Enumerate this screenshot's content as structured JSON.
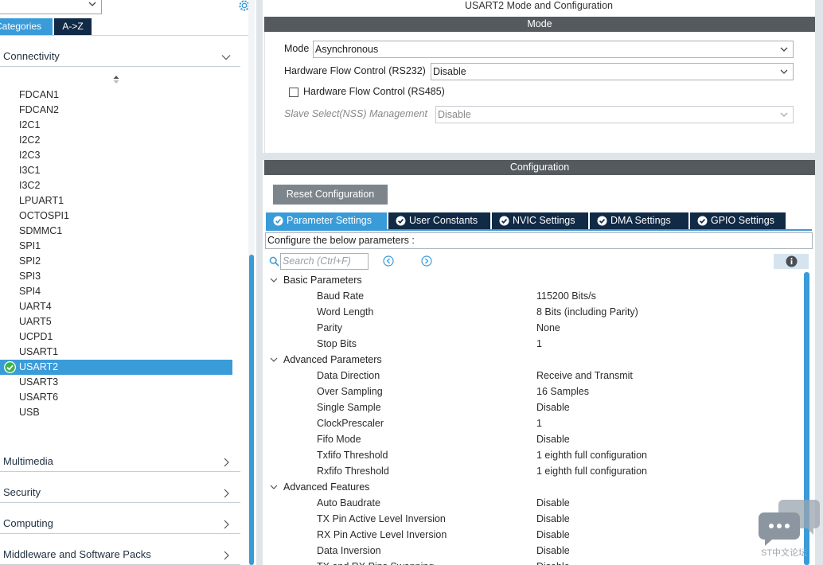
{
  "left_panel": {
    "tabs": {
      "categories": "Categories",
      "az": "A->Z"
    },
    "categories": [
      {
        "label": "Connectivity",
        "expanded": true
      },
      {
        "label": "Multimedia",
        "expanded": false
      },
      {
        "label": "Security",
        "expanded": false
      },
      {
        "label": "Computing",
        "expanded": false
      },
      {
        "label": "Middleware and Software Packs",
        "expanded": false
      }
    ],
    "peripherals": [
      "FDCAN1",
      "FDCAN2",
      "I2C1",
      "I2C2",
      "I2C3",
      "I3C1",
      "I3C2",
      "LPUART1",
      "OCTOSPI1",
      "SDMMC1",
      "SPI1",
      "SPI2",
      "SPI3",
      "SPI4",
      "UART4",
      "UART5",
      "UCPD1",
      "USART1",
      "USART2",
      "USART3",
      "USART6",
      "USB"
    ],
    "selected_index": 18
  },
  "mode_section": {
    "window_title": "USART2 Mode and Configuration",
    "header": "Mode",
    "mode": {
      "label": "Mode",
      "value": "Asynchronous"
    },
    "hw_flow_rs232": {
      "label": "Hardware Flow Control (RS232)",
      "value": "Disable"
    },
    "hw_flow_rs485": {
      "label": "Hardware Flow Control (RS485)",
      "checked": false
    },
    "slave_select": {
      "label": "Slave Select(NSS) Management",
      "value": "Disable",
      "disabled": true
    }
  },
  "config_section": {
    "header": "Configuration",
    "reset_label": "Reset Configuration",
    "tabs": [
      {
        "label": "Parameter Settings",
        "active": true
      },
      {
        "label": "User Constants",
        "active": false
      },
      {
        "label": "NVIC Settings",
        "active": false
      },
      {
        "label": "DMA Settings",
        "active": false
      },
      {
        "label": "GPIO Settings",
        "active": false
      }
    ],
    "configure_text": "Configure the below parameters :",
    "search_placeholder": "Search (Ctrl+F)",
    "groups": [
      {
        "name": "Basic Parameters",
        "params": [
          {
            "name": "Baud Rate",
            "value": "115200 Bits/s"
          },
          {
            "name": "Word Length",
            "value": "8 Bits (including Parity)"
          },
          {
            "name": "Parity",
            "value": "None"
          },
          {
            "name": "Stop Bits",
            "value": "1"
          }
        ]
      },
      {
        "name": "Advanced Parameters",
        "params": [
          {
            "name": "Data Direction",
            "value": "Receive and Transmit"
          },
          {
            "name": "Over Sampling",
            "value": "16 Samples"
          },
          {
            "name": "Single Sample",
            "value": "Disable"
          },
          {
            "name": "ClockPrescaler",
            "value": "1"
          },
          {
            "name": "Fifo Mode",
            "value": "Disable"
          },
          {
            "name": "Txfifo Threshold",
            "value": "1 eighth full configuration"
          },
          {
            "name": "Rxfifo Threshold",
            "value": "1 eighth full configuration"
          }
        ]
      },
      {
        "name": "Advanced Features",
        "params": [
          {
            "name": "Auto Baudrate",
            "value": "Disable"
          },
          {
            "name": "TX Pin Active Level Inversion",
            "value": "Disable"
          },
          {
            "name": "RX Pin Active Level Inversion",
            "value": "Disable"
          },
          {
            "name": "Data Inversion",
            "value": "Disable"
          },
          {
            "name": "TX and RX Pins Swapping",
            "value": "Disable"
          }
        ]
      }
    ]
  },
  "watermark": {
    "text": "ST中文论坛"
  },
  "colors": {
    "accent": "#3a9bd9",
    "navy": "#112a46",
    "header_bar": "#555a5f",
    "button_gray": "#7d858c"
  }
}
